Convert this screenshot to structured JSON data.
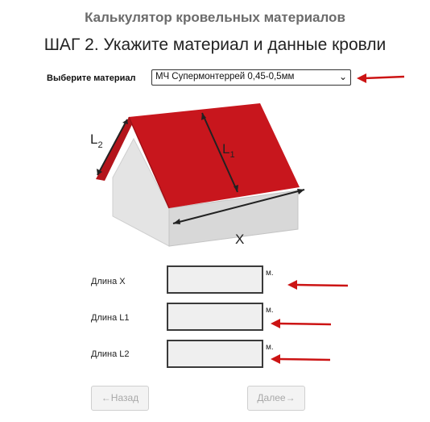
{
  "header": {
    "title": "Калькулятор кровельных материалов",
    "step": "ШАГ 2. Укажите материал и данные кровли"
  },
  "material": {
    "label": "Выберите материал",
    "selected": "МЧ Супермонтеррей 0,45-0,5мм"
  },
  "diagram": {
    "label_l2": "L",
    "label_l2_sub": "2",
    "label_l1": "L",
    "label_l1_sub": "1",
    "label_x": "X",
    "roof_color": "#c8161d",
    "wall_color": "#e6e6e6"
  },
  "fields": [
    {
      "label": "Длина X",
      "value": "",
      "unit": "м."
    },
    {
      "label": "Длина L1",
      "value": "",
      "unit": "м."
    },
    {
      "label": "Длина L2",
      "value": "",
      "unit": "м."
    }
  ],
  "buttons": {
    "back": "←Назад",
    "next": "Далее→"
  },
  "colors": {
    "arrow": "#cc1414"
  }
}
